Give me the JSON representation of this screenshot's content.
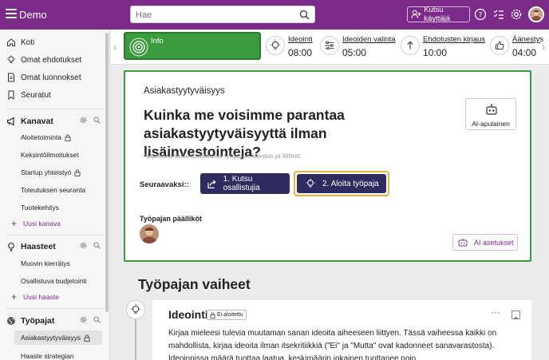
{
  "topbar": {
    "app_name": "Demo",
    "search_placeholder": "Hae",
    "invite_label": "Kutsu käyttäjä"
  },
  "sidebar": {
    "items": [
      {
        "label": "Koti",
        "icon": "home-icon"
      },
      {
        "label": "Omat ehdotukset",
        "icon": "lightbulb-icon"
      },
      {
        "label": "Omat luonnokset",
        "icon": "document-icon"
      },
      {
        "label": "Seuratut",
        "icon": "bookmark-icon"
      }
    ],
    "channels": {
      "title": "Kanavat",
      "items": [
        "Aloitetoiminta",
        "Keksintöilmoitukset",
        "Startup yhteistyö",
        "Toteutuksen seuranta",
        "Tuotekehitys"
      ],
      "add_label": "Uusi kanava"
    },
    "challenges": {
      "title": "Haasteet",
      "items": [
        "Muovin kierrätys",
        "Osallistuva budjetointi"
      ],
      "add_label": "Uusi haaste"
    },
    "workshops": {
      "title": "Työpajat",
      "items": [
        "Asiakastyytyväisyys",
        "Haaste strategian"
      ]
    }
  },
  "phases": {
    "active": {
      "label": "Info"
    },
    "items": [
      {
        "title": "Ideointi",
        "time": "08:00"
      },
      {
        "title": "Ideoiden valinta",
        "time": "05:00"
      },
      {
        "title": "Ehdotusten kirjaus",
        "time": "10:00"
      },
      {
        "title": "Äänestys",
        "time": "04:00"
      }
    ]
  },
  "card": {
    "label": "Asiakastyytyväisyys",
    "title": "Kuinka me voisimme parantaa asiakastyytyväisyyttä ilman lisäinvestointeja?",
    "description_placeholder": "Napsauta tästä lisätäksesi työpajan kuvaus ja liitteet.",
    "ai_assistant_label": "AI-apulainen",
    "next_label": "Seuraavaksi::",
    "invite_participants": "1. Kutsu osallistujia",
    "start_workshop": "2. Aloita työpaja",
    "leads_label": "Työpajan päälliköt",
    "ai_settings": "AI asetukset"
  },
  "steps": {
    "title": "Työpajan vaiheet",
    "phase": {
      "title": "Ideointi",
      "badge": "Ei aloitettu",
      "more": "···",
      "text": "Kirjaa mieleesi tulevia muutaman sanan ideoita aiheeseen liittyen. Tässä vaiheessa kaikki on mahdollista, kirjaa ideoita ilman itsekritiikkiä (\"Ei\" ja \"Mutta\" ovat kadonneet sanavarastosta). Ideoinnissa määrä tuottaa laatua, keskimäärin jokainen tuottanee noin"
    }
  },
  "colors": {
    "brand": "#7b2a8a",
    "active_phase": "#3c9a3f",
    "primary_button": "#2e2c5e",
    "highlight": "#e0b44a"
  }
}
